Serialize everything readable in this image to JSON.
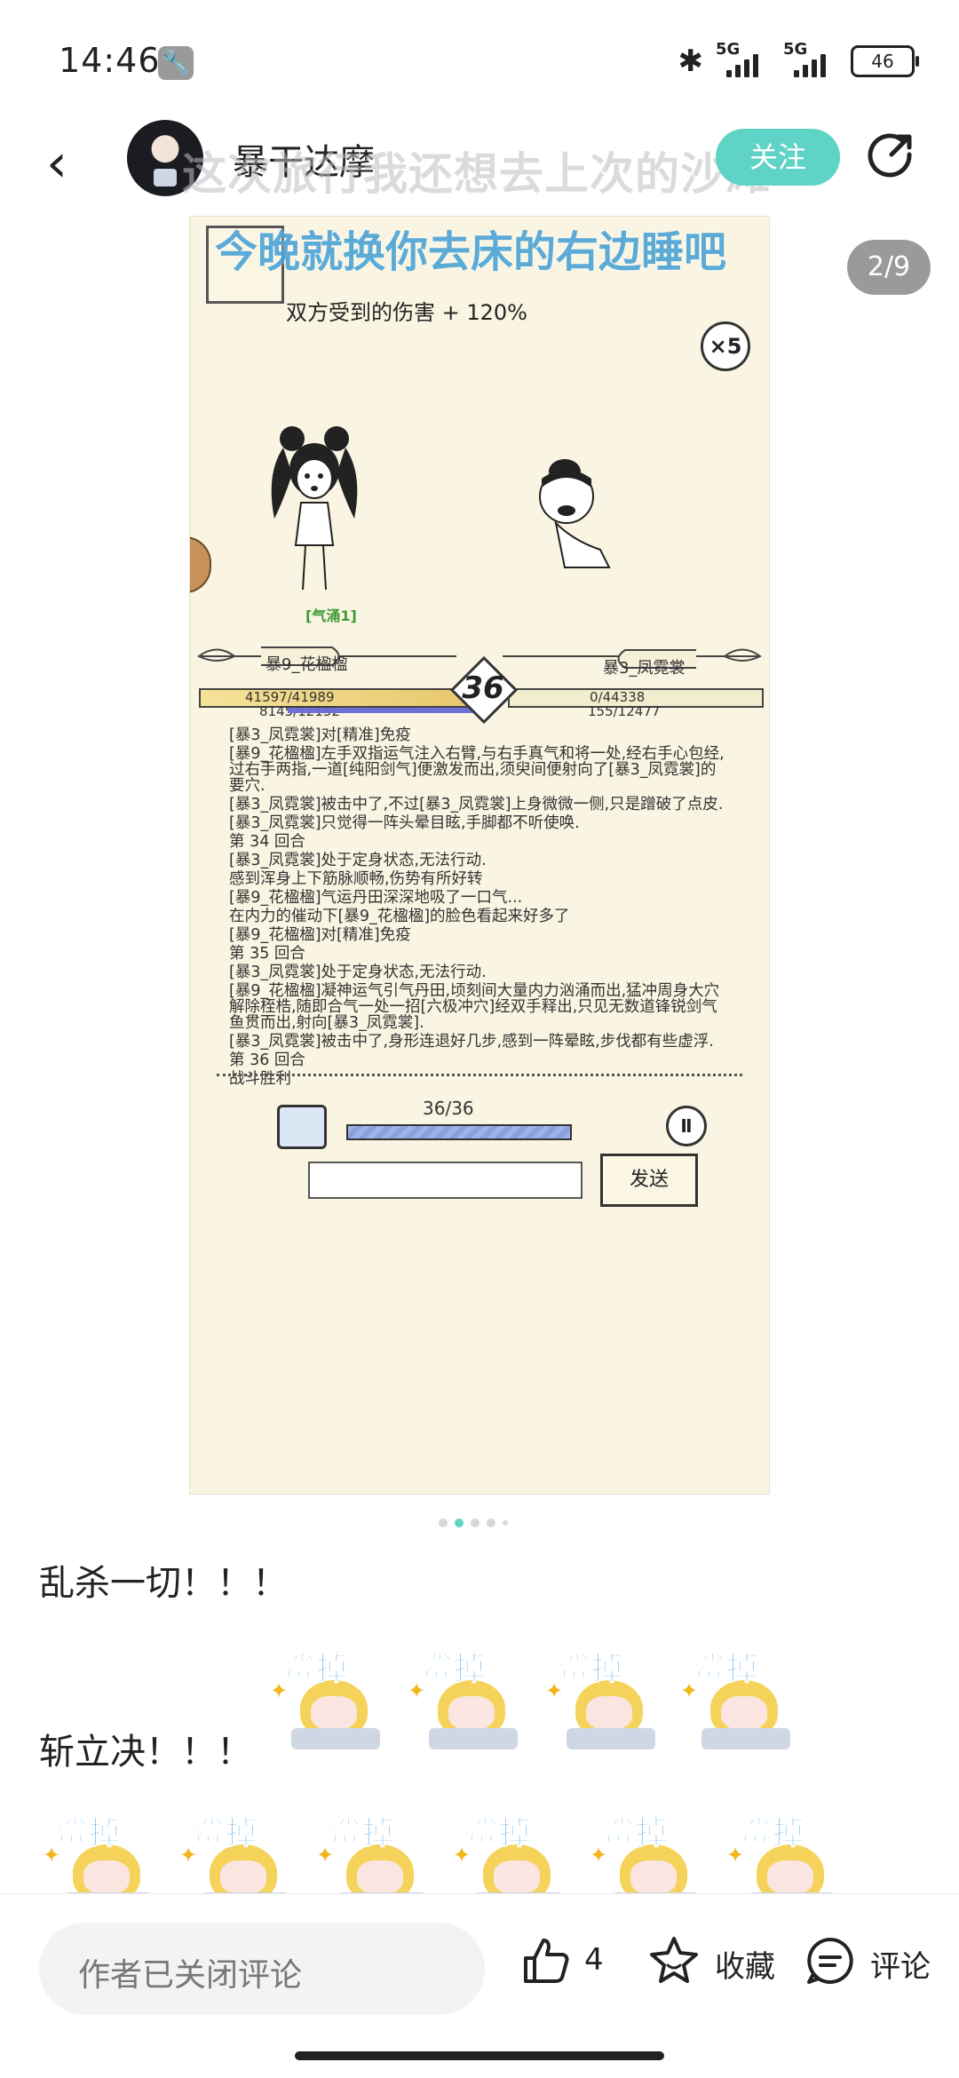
{
  "status_bar": {
    "time": "14:46",
    "bluetooth": "✱",
    "signal1": "5G",
    "signal2": "5G",
    "battery": "46"
  },
  "header": {
    "author": "暴干达摩",
    "follow_label": "关注",
    "overlay_text_1": "这次旅行我还想去上次的沙滩",
    "overlay_text_2": "今晚就换你去床的右边睡吧"
  },
  "gallery": {
    "counter": "2/9"
  },
  "game": {
    "damage_text": "双方受到的伤害 + 120%",
    "multiplier": "×5",
    "buff": "[气涌1]",
    "player1": {
      "name": "暴9_花楹楹",
      "hp": "41597/41989",
      "mp": "8145/12152"
    },
    "player2": {
      "name": "暴3_凤霓裳",
      "hp": "0/44338",
      "mp": "155/12477"
    },
    "round": "36",
    "log": [
      "[暴3_凤霓裳]对[精准]免疫",
      "[暴9_花楹楹]左手双指运气注入右臂,与右手真气和将一处,经右手心包经,过右手两指,一道[纯阳剑气]便激发而出,须臾间便射向了[暴3_凤霓裳]的要穴.",
      "[暴3_凤霓裳]被击中了,不过[暴3_凤霓裳]上身微微一侧,只是蹭破了点皮.",
      "[暴3_凤霓裳]只觉得一阵头晕目眩,手脚都不听使唤.",
      "第 34 回合",
      "[暴3_凤霓裳]处于定身状态,无法行动.",
      "感到浑身上下筋脉顺畅,伤势有所好转",
      "[暴9_花楹楹]气运丹田深深地吸了一口气...",
      "在内力的催动下[暴9_花楹楹]的脸色看起来好多了",
      "[暴9_花楹楹]对[精准]免疫",
      "第 35 回合",
      "[暴3_凤霓裳]处于定身状态,无法行动.",
      "[暴9_花楹楹]凝神运气引气丹田,顷刻间大量内力汹涌而出,猛冲周身大穴解除桎梏,随即合气一处一招[六极冲穴]经双手释出,只见无数道锋锐剑气鱼贯而出,射向[暴3_凤霓裳].",
      "[暴3_凤霓裳]被击中了,身形连退好几步,感到一阵晕眩,步伐都有些虚浮.",
      "第 36 回合",
      "战斗胜利"
    ],
    "progress_label": "36/36",
    "progress": 1.0,
    "send_label": "发送"
  },
  "post": {
    "line1": "乱杀一切！！！",
    "line2": "斩立决！！！",
    "sticker_text": "鲨掉"
  },
  "bottom_bar": {
    "comment_placeholder": "作者已关闭评论",
    "like_count": "4",
    "favorite_label": "收藏",
    "comment_label": "评论"
  },
  "colors": {
    "accent": "#5fd3c5",
    "overlay_blue": "#4ba3d6",
    "game_bg": "#faf5e2"
  }
}
